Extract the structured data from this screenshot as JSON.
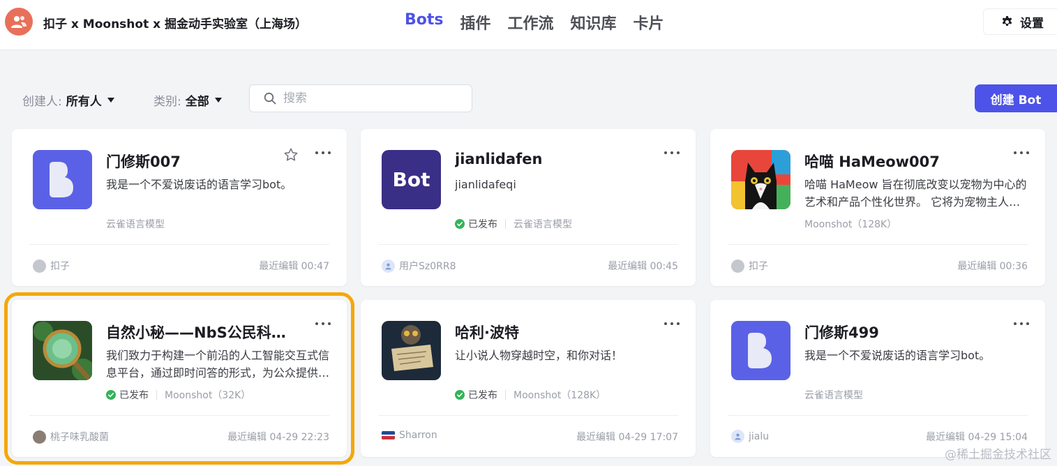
{
  "workspace": {
    "name": "扣子 x Moonshot x 掘金动手实验室（上海场）"
  },
  "nav": [
    {
      "label": "Bots",
      "active": true
    },
    {
      "label": "插件",
      "active": false
    },
    {
      "label": "工作流",
      "active": false
    },
    {
      "label": "知识库",
      "active": false
    },
    {
      "label": "卡片",
      "active": false
    }
  ],
  "settings_label": "设置",
  "filters": {
    "creator": {
      "label": "创建人:",
      "value": "所有人"
    },
    "category": {
      "label": "类别:",
      "value": "全部"
    }
  },
  "search": {
    "placeholder": "搜索"
  },
  "create_button": "创建 Bot",
  "cards": [
    {
      "title": "门修斯007",
      "desc": "我是一个不爱说废话的语言学习bot。",
      "published": "",
      "model": "云雀语言模型",
      "creator": "扣子",
      "edited": "最近编辑 00:47"
    },
    {
      "title": "jianlidafen",
      "desc": "jianlidafeqi",
      "published": "已发布",
      "model": "云雀语言模型",
      "creator": "用户Sz0RR8",
      "edited": "最近编辑 00:45",
      "avatar_text": "Bot"
    },
    {
      "title": "哈喵 HaMeow007",
      "desc": "哈喵 HaMeow 旨在彻底改变以宠物为中心的艺术和产品个性化世界。 它将为宠物主人提供独特的服务",
      "published": "",
      "model": "Moonshot（128K）",
      "creator": "扣子",
      "edited": "最近编辑 00:36"
    },
    {
      "title": "自然小秘——NbS公民科学助手",
      "desc": "我们致力于构建一个前沿的人工智能交互式信息平台，通过即时问答的形式，为公众提供信息",
      "published": "已发布",
      "model": "Moonshot（32K）",
      "creator": "桃子味乳酸菌",
      "edited": "最近编辑 04-29 22:23"
    },
    {
      "title": "哈利·波特",
      "desc": "让小说人物穿越时空，和你对话！",
      "published": "已发布",
      "model": "Moonshot（128K）",
      "creator": "Sharron",
      "edited": "最近编辑 04-29 17:07"
    },
    {
      "title": "门修斯499",
      "desc": "我是一个不爱说废话的语言学习bot。",
      "published": "",
      "model": "云雀语言模型",
      "creator": "jialu",
      "edited": "最近编辑 04-29 15:04"
    }
  ],
  "watermark": "@稀土掘金技术社区",
  "colors": {
    "accent": "#4d53e8",
    "highlight": "#f5a70a",
    "published": "#34b35a"
  }
}
